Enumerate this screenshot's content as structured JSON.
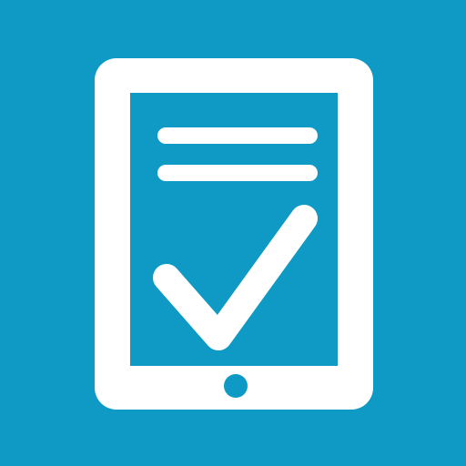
{
  "icon": {
    "name": "tablet-checklist-icon",
    "background_color": "#0e9ac4",
    "foreground_color": "#ffffff",
    "screen_color": "#0e9ac4"
  }
}
